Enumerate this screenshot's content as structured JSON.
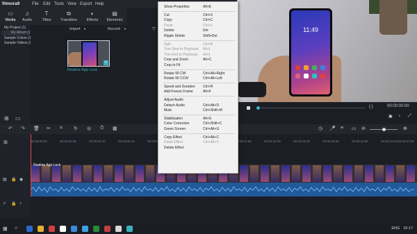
{
  "app": {
    "logo": "filmora9",
    "menus": [
      "File",
      "Edit",
      "Tools",
      "View",
      "Export",
      "Help"
    ]
  },
  "window_controls": [
    "⎕",
    "−",
    "□",
    "✕"
  ],
  "tabs": [
    {
      "label": "Media",
      "icon": "folder-icon"
    },
    {
      "label": "Audio",
      "icon": "music-icon"
    },
    {
      "label": "Titles",
      "icon": "title-icon"
    },
    {
      "label": "Transition",
      "icon": "transition-icon"
    },
    {
      "label": "Effects",
      "icon": "effects-icon"
    },
    {
      "label": "Elements",
      "icon": "elements-icon"
    }
  ],
  "sidebar": {
    "project": "My Project (1)",
    "album": "My Album (1)",
    "sample_colors": "Sample Colors (15)",
    "sample_videos": "Sample Videos (9)"
  },
  "media_panel": {
    "import": "Import",
    "record": "Record",
    "clip_label": "Realme App Lock"
  },
  "preview": {
    "time": "11:49",
    "timecode": "00:00:00:00",
    "brackets": "{ }"
  },
  "ruler": [
    "00:00:00:00",
    "00:00:02:05",
    "00:00:04:10",
    "00:00:06:15",
    "00:00:08:20",
    "00:00:10:25",
    "00:00:12:30",
    "00:00:14:35",
    "00:00:16:40",
    "00:00:18:45",
    "00:00:20:50",
    "00:00:22:55",
    "00:00:24:60",
    "00:00:27:05"
  ],
  "video_clip_label": "Realme App Lock",
  "context_menu": [
    {
      "label": "Show Properties",
      "shortcut": "Alt+E",
      "enabled": true
    },
    {
      "sep": true
    },
    {
      "label": "Cut",
      "shortcut": "Ctrl+X",
      "enabled": true
    },
    {
      "label": "Copy",
      "shortcut": "Ctrl+C",
      "enabled": true
    },
    {
      "label": "Paste",
      "shortcut": "Ctrl+V",
      "enabled": false
    },
    {
      "label": "Delete",
      "shortcut": "Del",
      "enabled": true
    },
    {
      "label": "Ripple Delete",
      "shortcut": "Shift+Del",
      "enabled": true
    },
    {
      "sep": true
    },
    {
      "label": "Split",
      "shortcut": "Ctrl+B",
      "enabled": false
    },
    {
      "label": "Trim Start to Playhead",
      "shortcut": "Alt+[",
      "enabled": false
    },
    {
      "label": "Trim End to Playhead",
      "shortcut": "Alt+]",
      "enabled": false
    },
    {
      "label": "Crop and Zoom",
      "shortcut": "Alt+C",
      "enabled": true
    },
    {
      "label": "Crop to Fit",
      "shortcut": "",
      "enabled": true
    },
    {
      "sep": true
    },
    {
      "label": "Rotate 90 CW",
      "shortcut": "Ctrl+Alt+Right",
      "enabled": true
    },
    {
      "label": "Rotate 90 CCW",
      "shortcut": "Ctrl+Alt+Left",
      "enabled": true
    },
    {
      "sep": true
    },
    {
      "label": "Speed and Duration",
      "shortcut": "Ctrl+R",
      "enabled": true
    },
    {
      "label": "Add Freeze Frame",
      "shortcut": "Alt+F",
      "enabled": true
    },
    {
      "sep": true
    },
    {
      "label": "Adjust Audio",
      "shortcut": "",
      "enabled": true
    },
    {
      "label": "Detach Audio",
      "shortcut": "Ctrl+Alt+D",
      "enabled": true
    },
    {
      "label": "Mute",
      "shortcut": "Ctrl+Shift+M",
      "enabled": true
    },
    {
      "sep": true
    },
    {
      "label": "Stabilization",
      "shortcut": "Alt+S",
      "enabled": true
    },
    {
      "label": "Color Correction",
      "shortcut": "Ctrl+Shift+C",
      "enabled": true
    },
    {
      "label": "Green Screen",
      "shortcut": "Ctrl+Alt+G",
      "enabled": true
    },
    {
      "sep": true
    },
    {
      "label": "Copy Effect",
      "shortcut": "Ctrl+Alt+C",
      "enabled": true
    },
    {
      "label": "Paste Effect",
      "shortcut": "Ctrl+Alt+V",
      "enabled": false
    },
    {
      "label": "Delete Effect",
      "shortcut": "",
      "enabled": true
    }
  ],
  "tray": {
    "lang": "ENG",
    "clock": "16:17"
  }
}
